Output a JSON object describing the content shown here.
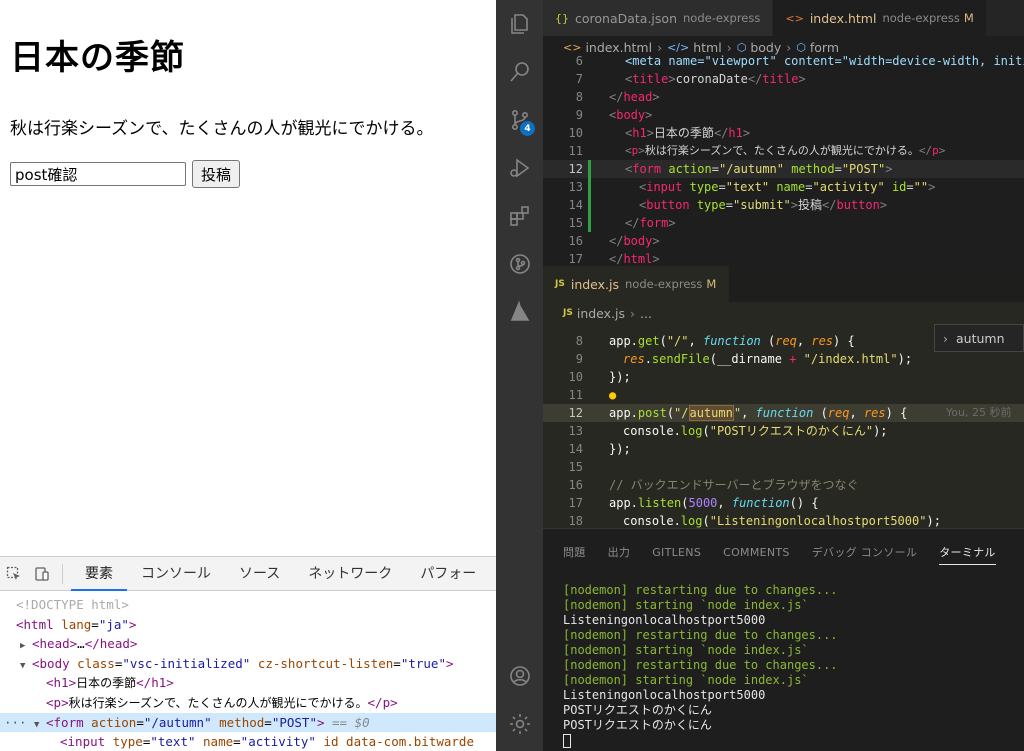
{
  "browser": {
    "heading": "日本の季節",
    "paragraph": "秋は行楽シーズンで、たくさんの人が観光にでかける。",
    "input_value": "post確認",
    "submit_label": "投稿"
  },
  "devtools": {
    "tabs": [
      "要素",
      "コンソール",
      "ソース",
      "ネットワーク",
      "パフォー"
    ],
    "dom": {
      "doctype": "<!DOCTYPE html>",
      "html_tag": "html",
      "html_lang_attr": "lang",
      "html_lang_val": "\"ja\"",
      "head_tag": "head",
      "head_ellipsis": "…",
      "body_tag": "body",
      "body_class_attr": "class",
      "body_class_val": "\"vsc-initialized\"",
      "body_cz_attr": "cz-shortcut-listen",
      "body_cz_val": "\"true\"",
      "h1_tag": "h1",
      "h1_text": "日本の季節",
      "p_tag": "p",
      "p_text": "秋は行楽シーズンで、たくさんの人が観光にでかける。",
      "form_tag": "form",
      "form_action_attr": "action",
      "form_action_val": "\"/autumn\"",
      "form_method_attr": "method",
      "form_method_val": "\"POST\"",
      "form_eq": "== $0",
      "input_tag": "input",
      "input_type_attr": "type",
      "input_type_val": "\"text\"",
      "input_name_attr": "name",
      "input_name_val": "\"activity\"",
      "input_rest": "id data-com.bitwarde",
      "dots": "···"
    }
  },
  "vscode": {
    "scm_badge": "4",
    "editor1": {
      "tabs": [
        {
          "icon": "{}",
          "name": "coronaData.json",
          "desc": "node-express",
          "mod": ""
        },
        {
          "icon": "<>",
          "name": "index.html",
          "desc": "node-express",
          "mod": "M"
        }
      ],
      "breadcrumb": [
        "index.html",
        "html",
        "body",
        "form"
      ],
      "lines": {
        "n6": "6",
        "n7": "7",
        "n8": "8",
        "n9": "9",
        "n10": "10",
        "n11": "11",
        "n12": "12",
        "n13": "13",
        "n14": "14",
        "n15": "15",
        "n16": "16",
        "n17": "17",
        "l6": "<meta name=\"viewport\" content=\"width=device-width, initi",
        "l7_title_text": "coronaDate",
        "l10_h1_text": "日本の季節",
        "l11_p_text": "秋は行楽シーズンで、たくさんの人が観光にでかける。",
        "l12_action": "\"/autumn\"",
        "l12_method": "\"POST\"",
        "l13_type": "\"text\"",
        "l13_name": "\"activity\"",
        "l13_id": "\"\"",
        "l14_type": "\"submit\"",
        "l14_text": "投稿"
      }
    },
    "editor2": {
      "tab": {
        "icon": "JS",
        "name": "index.js",
        "desc": "node-express",
        "mod": "M"
      },
      "breadcrumb": [
        "index.js",
        "..."
      ],
      "suggest": "autumn",
      "blame": "You, 25 秒前",
      "lines": {
        "n8": "8",
        "n9": "9",
        "n10": "10",
        "n11": "11",
        "n12": "12",
        "n13": "13",
        "n14": "14",
        "n15": "15",
        "n16": "16",
        "n17": "17",
        "n18": "18",
        "l8_path": "\"/\"",
        "l9_str": "\"/index.html\"",
        "l12_path_open": "\"/",
        "l12_path_word": "autumn",
        "l12_path_close": "\"",
        "l13_str": "\"POSTリクエストのかくにん\"",
        "l16_comment": "// バックエンドサーバーとブラウザをつなぐ",
        "l17_port": "5000",
        "l18_str": "\"Listeningonlocalhostport5000\""
      }
    },
    "panel": {
      "tabs": [
        "問題",
        "出力",
        "GITLENS",
        "COMMENTS",
        "デバッグ コンソール",
        "ターミナル"
      ],
      "terminal": [
        {
          "text": "[nodemon] restarting due to changes...",
          "color": "green"
        },
        {
          "text": "[nodemon] starting `node index.js`",
          "color": "green"
        },
        {
          "text": "Listeningonlocalhostport5000",
          "color": "white"
        },
        {
          "text": "[nodemon] restarting due to changes...",
          "color": "green"
        },
        {
          "text": "[nodemon] starting `node index.js`",
          "color": "green"
        },
        {
          "text": "[nodemon] restarting due to changes...",
          "color": "green"
        },
        {
          "text": "[nodemon] starting `node index.js`",
          "color": "green"
        },
        {
          "text": "Listeningonlocalhostport5000",
          "color": "white"
        },
        {
          "text": "POSTリクエストのかくにん",
          "color": "white"
        },
        {
          "text": "POSTリクエストのかくにん",
          "color": "white"
        }
      ]
    }
  }
}
